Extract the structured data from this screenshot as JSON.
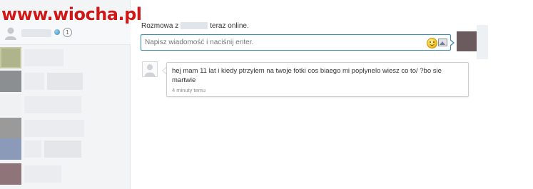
{
  "watermark": {
    "text": "www.wiocha.pl"
  },
  "sidebar": {
    "profile": {
      "badge": "1"
    },
    "contacts": [
      {
        "thumb_color": "#b0b48c",
        "kind": "green"
      },
      {
        "thumb_color": "#8c8f92",
        "kind": "gray"
      },
      {
        "thumb_color": "#f0f1f3",
        "kind": "empty"
      },
      {
        "thumb_color": "#9a9a9b",
        "kind": "gray"
      },
      {
        "thumb_color": "#8a9ab8",
        "kind": "blue"
      },
      {
        "thumb_color": "#8f7479",
        "kind": "mauve"
      }
    ]
  },
  "chat": {
    "header_prefix": "Rozmowa z",
    "header_suffix": "teraz online.",
    "input_placeholder": "Napisz wiadomość i naciśnij enter.",
    "message": {
      "text": "hej mam 11 lat i kiedy ptrzylem na twoje fotki cos biaego mi poplynelo wiesz co to/ ?bo sie martwie",
      "time": "4 minuty temu"
    }
  },
  "colors": {
    "accent_border": "#3c8bb0",
    "watermark_red": "#d01818"
  }
}
